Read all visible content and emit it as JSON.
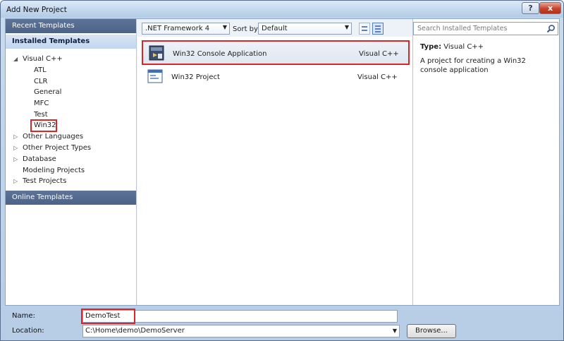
{
  "window": {
    "title": "Add New Project",
    "help_label": "?",
    "close_label": "x"
  },
  "left_pane": {
    "recent_templates": "Recent Templates",
    "installed_templates": "Installed Templates",
    "online_templates": "Online Templates",
    "tree": {
      "visual_cpp": "Visual C++",
      "children": [
        "ATL",
        "CLR",
        "General",
        "MFC",
        "Test",
        "Win32"
      ],
      "other_languages": "Other Languages",
      "other_project_types": "Other Project Types",
      "database": "Database",
      "modeling_projects": "Modeling Projects",
      "test_projects": "Test Projects"
    }
  },
  "toolbar": {
    "framework": ".NET Framework 4",
    "sort_by_label": "Sort by:",
    "sort_by_value": "Default"
  },
  "templates": [
    {
      "name": "Win32 Console Application",
      "language": "Visual C++",
      "selected": true
    },
    {
      "name": "Win32 Project",
      "language": "Visual C++",
      "selected": false
    }
  ],
  "right_pane": {
    "search_placeholder": "Search Installed Templates",
    "type_label": "Type:",
    "type_value": "Visual C++",
    "description": "A project for creating a Win32 console application"
  },
  "bottom": {
    "name_label": "Name:",
    "name_value": "DemoTest",
    "location_label": "Location:",
    "location_value": "C:\\Home\\demo\\DemoServer",
    "browse_label": "Browse..."
  },
  "colors": {
    "highlight_red": "#d9262a",
    "header_blue": "#4c6286",
    "accent_blue": "#5e81b9"
  },
  "icons": {
    "search": "search-icon",
    "console_app": "console-app-icon",
    "win32_project": "window-app-icon"
  }
}
